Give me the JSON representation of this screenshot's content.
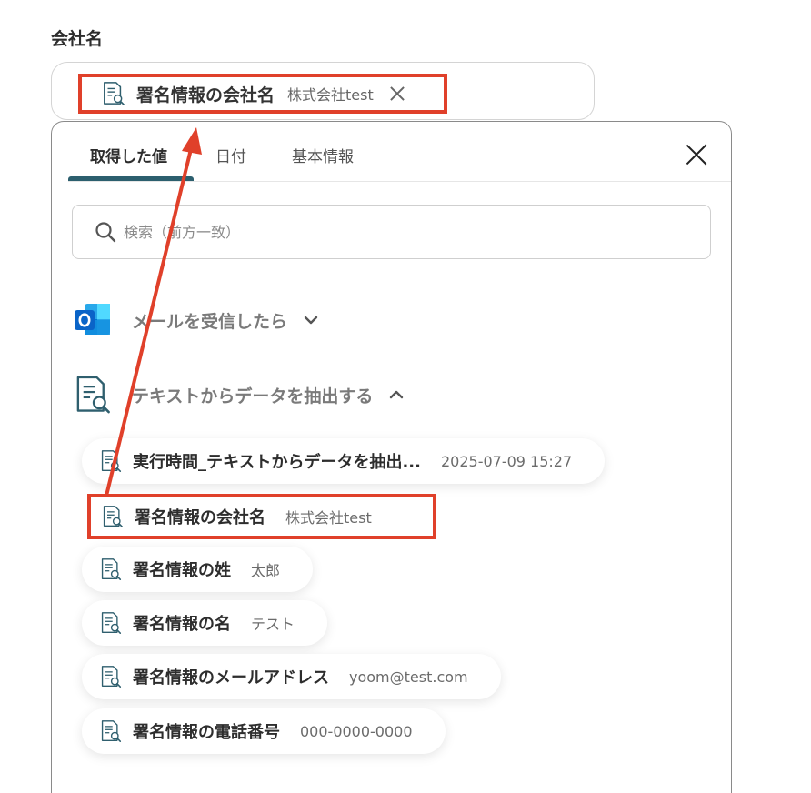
{
  "field": {
    "label": "会社名"
  },
  "selected_tag": {
    "name": "署名情報の会社名",
    "value": "株式会社test",
    "icon": "document-search-icon"
  },
  "tabs": [
    {
      "label": "取得した値",
      "active": true
    },
    {
      "label": "日付",
      "active": false
    },
    {
      "label": "基本情報",
      "active": false
    }
  ],
  "search": {
    "placeholder": "検索（前方一致）"
  },
  "sections": [
    {
      "title": "メールを受信したら",
      "icon": "outlook-icon",
      "expanded": false
    },
    {
      "title": "テキストからデータを抽出する",
      "icon": "document-search-icon",
      "expanded": true
    }
  ],
  "items": [
    {
      "name": "実行時間_テキストからデータを抽出...",
      "value": "2025-07-09 15:27"
    },
    {
      "name": "署名情報の会社名",
      "value": "株式会社test"
    },
    {
      "name": "署名情報の姓",
      "value": "太郎"
    },
    {
      "name": "署名情報の名",
      "value": "テスト"
    },
    {
      "name": "署名情報のメールアドレス",
      "value": "yoom@test.com"
    },
    {
      "name": "署名情報の電話番号",
      "value": "000-0000-0000"
    }
  ],
  "colors": {
    "highlight": "#e0402a",
    "accent": "#2c5f6e",
    "outlook_blue": "#0a64c8"
  }
}
